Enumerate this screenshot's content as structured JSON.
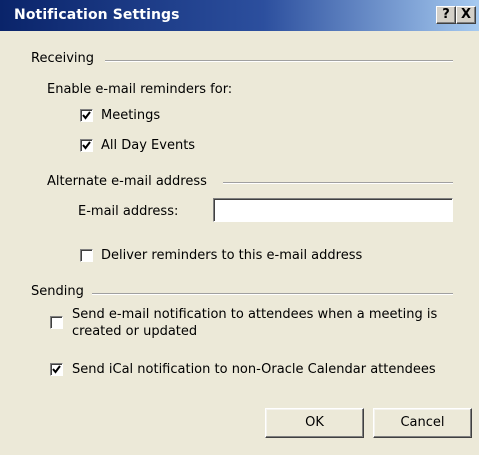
{
  "window": {
    "title": "Notification Settings",
    "help_label": "?",
    "close_label": "X"
  },
  "receiving": {
    "section_label": "Receiving",
    "enable_label": "Enable e-mail reminders for:",
    "meetings": {
      "label": "Meetings",
      "checked": true
    },
    "all_day_events": {
      "label": "All Day Events",
      "checked": true
    },
    "alternate_label": "Alternate e-mail address",
    "email_label": "E-mail address:",
    "email_value": "",
    "deliver": {
      "label": "Deliver reminders to this e-mail address",
      "checked": false
    }
  },
  "sending": {
    "section_label": "Sending",
    "send_email": {
      "label_line1": "Send e-mail notification to attendees when a meeting is",
      "label_line2": "created or updated",
      "checked": false
    },
    "send_ical": {
      "label": "Send iCal notification to non-Oracle Calendar attendees",
      "checked": true
    }
  },
  "buttons": {
    "ok": "OK",
    "cancel": "Cancel"
  }
}
